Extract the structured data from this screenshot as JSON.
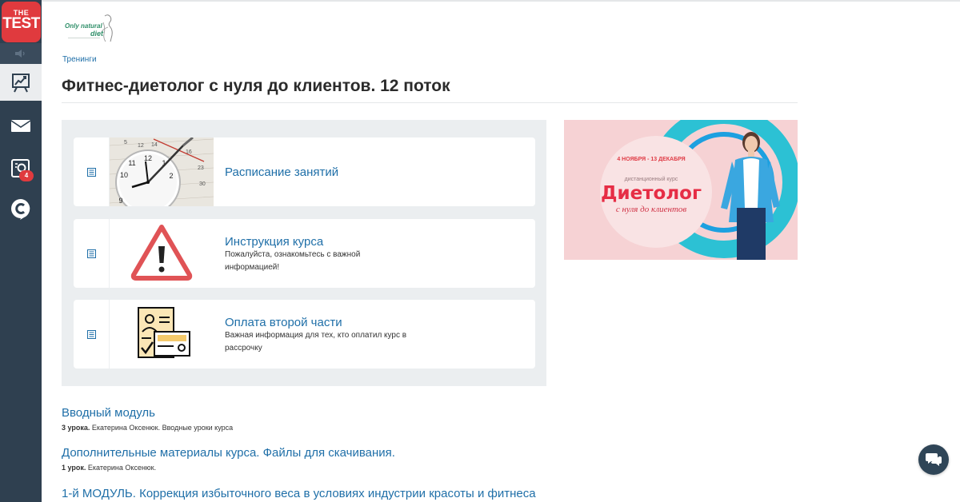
{
  "sidebar": {
    "logo": {
      "line1": "THE",
      "line2": "TEST"
    },
    "items": [
      {
        "icon": "chart-easel-icon",
        "active": true
      },
      {
        "icon": "envelope-icon",
        "active": false
      },
      {
        "icon": "certificate-icon",
        "active": false,
        "badge": "4"
      },
      {
        "icon": "chat-c-icon",
        "active": false
      }
    ]
  },
  "brand": {
    "line1": "Only natural",
    "line2": "diet"
  },
  "breadcrumb": "Тренинги",
  "page_title": "Фитнес-диетолог с нуля до клиентов. 12 поток",
  "cards": [
    {
      "title": "Расписание занятий",
      "description": ""
    },
    {
      "title": "Инструкция курса",
      "description": "Пожалуйста, ознакомьтесь с важной информацией!"
    },
    {
      "title": "Оплата второй части",
      "description": "Важная информация для тех, кто оплатил курс в рассрочку"
    }
  ],
  "banner": {
    "dates": "4 НОЯБРЯ - 13 ДЕКАБРЯ",
    "subtitle": "дистанционный курс",
    "title": "Диетолог",
    "tagline": "с нуля до клиентов"
  },
  "modules": [
    {
      "title": "Вводный модуль",
      "lessons": "3 урока.",
      "meta": "Екатерина Оксенюк. Вводные уроки курса"
    },
    {
      "title": "Дополнительные материалы курса. Файлы для скачивания.",
      "lessons": "1 урок.",
      "meta": "Екатерина Оксенюк."
    },
    {
      "title": "1-й МОДУЛЬ. Коррекция избыточного веса в условиях индустрии красоты и фитнеса",
      "lessons": "",
      "meta": ""
    }
  ],
  "colors": {
    "sidebar": "#2f4050",
    "link": "#1f6fa8",
    "accent_red": "#e03a3e",
    "panel": "#ebeef0"
  }
}
